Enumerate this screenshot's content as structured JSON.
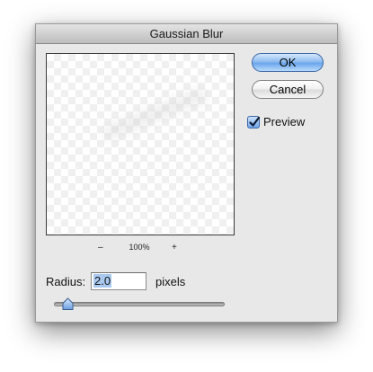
{
  "dialog": {
    "title": "Gaussian Blur"
  },
  "buttons": {
    "ok_label": "OK",
    "cancel_label": "Cancel"
  },
  "preview_option": {
    "label": "Preview",
    "checked": true
  },
  "zoom": {
    "minus_symbol": "–",
    "level": "100%",
    "plus_symbol": "+"
  },
  "radius": {
    "label": "Radius:",
    "value": "2.0",
    "unit": "pixels",
    "slider_level_fraction": 0.08
  },
  "colors": {
    "dialog_background": "#e8e8e8",
    "default_button_blue": "#6aa6ec",
    "checkbox_blue": "#6ea6e9"
  },
  "icons": {
    "checkbox_mark": "checkmark-icon",
    "slider_thumb": "slider-thumb-icon"
  }
}
